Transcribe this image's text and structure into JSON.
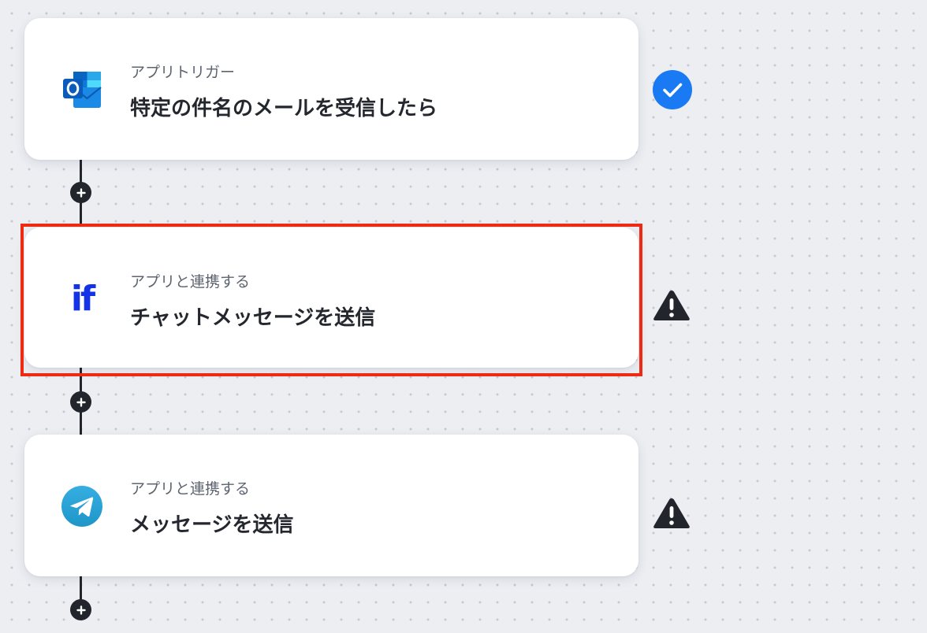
{
  "steps": [
    {
      "subtitle": "アプリトリガー",
      "title": "特定の件名のメールを受信したら",
      "app_icon": "outlook-icon",
      "status": "completed",
      "status_icon": "checkmark-circle-icon"
    },
    {
      "subtitle": "アプリと連携する",
      "title": "チャットメッセージを送信",
      "app_icon": "if-app-icon",
      "app_icon_text": "if",
      "status": "warning",
      "status_icon": "warning-triangle-icon",
      "highlighted": true
    },
    {
      "subtitle": "アプリと連携する",
      "title": "メッセージを送信",
      "app_icon": "telegram-icon",
      "status": "warning",
      "status_icon": "warning-triangle-icon"
    }
  ],
  "colors": {
    "accent_blue": "#1a7af4",
    "warning_dark": "#22252b",
    "highlight_red": "#ee2a12",
    "if_brand": "#1433e6",
    "outlook_blue": "#0a64c4",
    "telegram_blue": "#2a9fd8"
  }
}
